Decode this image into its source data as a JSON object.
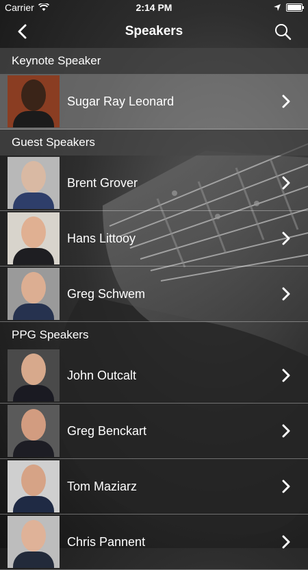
{
  "status": {
    "carrier": "Carrier",
    "time": "2:14 PM"
  },
  "nav": {
    "title": "Speakers"
  },
  "colors": {
    "row_highlight": "#969696",
    "section_header": "#464646"
  },
  "sections": [
    {
      "title": "Keynote Speaker",
      "speakers": [
        {
          "name": "Sugar Ray Leonard"
        }
      ]
    },
    {
      "title": "Guest Speakers",
      "speakers": [
        {
          "name": "Brent Grover"
        },
        {
          "name": "Hans Littooy"
        },
        {
          "name": "Greg Schwem"
        }
      ]
    },
    {
      "title": "PPG Speakers",
      "speakers": [
        {
          "name": "John Outcalt"
        },
        {
          "name": "Greg Benckart"
        },
        {
          "name": "Tom Maziarz"
        },
        {
          "name": "Chris Pannent"
        }
      ]
    }
  ]
}
